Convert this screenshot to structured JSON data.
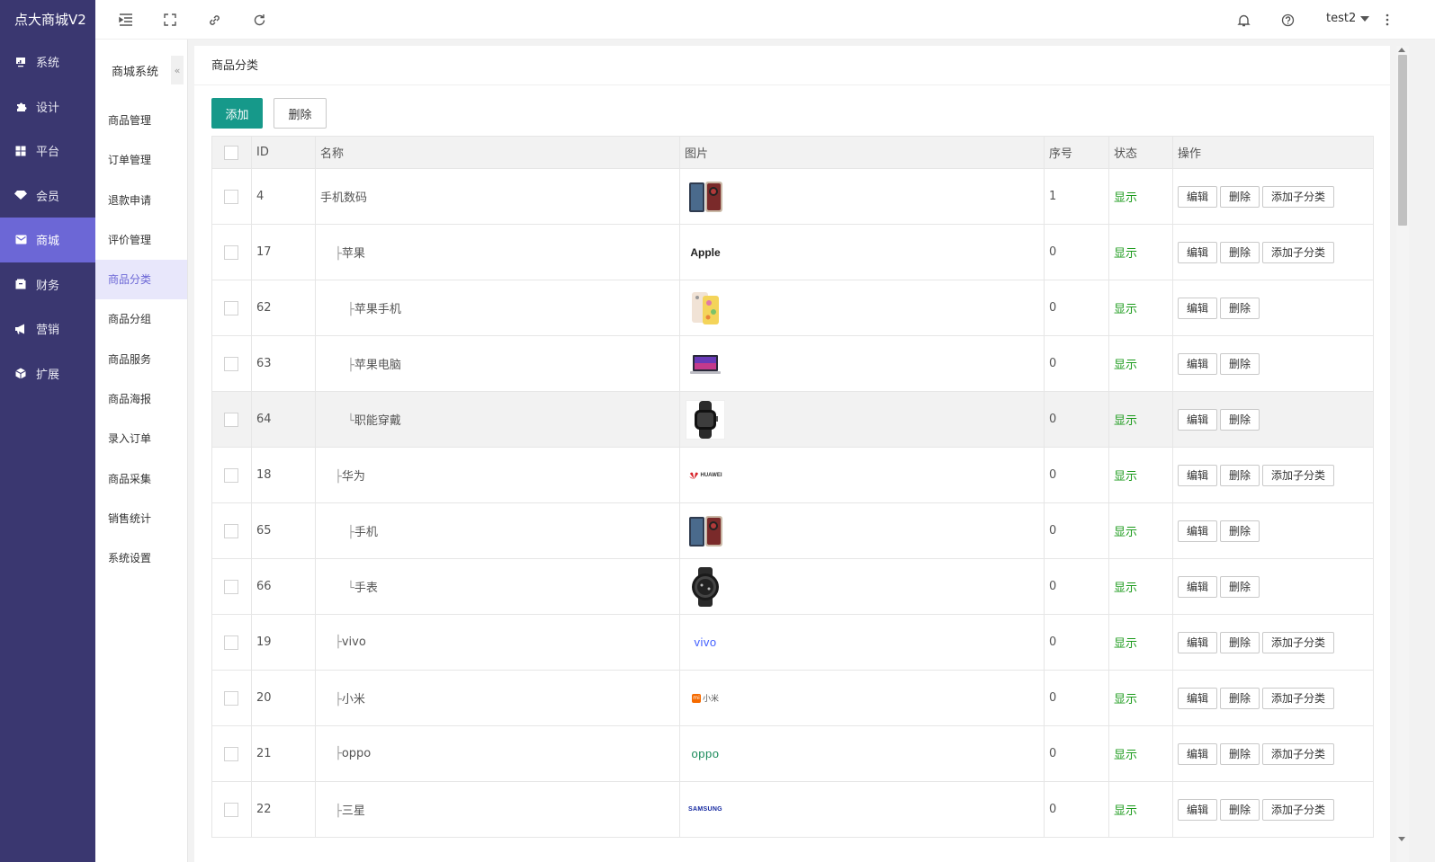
{
  "brand": "点大商城V2",
  "nav": [
    {
      "label": "系统",
      "icon": "monitor-icon"
    },
    {
      "label": "设计",
      "icon": "puzzle-icon"
    },
    {
      "label": "平台",
      "icon": "grid-icon"
    },
    {
      "label": "会员",
      "icon": "diamond-icon"
    },
    {
      "label": "商城",
      "icon": "mail-icon"
    },
    {
      "label": "财务",
      "icon": "wallet-icon"
    },
    {
      "label": "营销",
      "icon": "megaphone-icon"
    },
    {
      "label": "扩展",
      "icon": "cube-icon"
    }
  ],
  "subnav": {
    "title": "商城系统",
    "collapse": "«",
    "items": [
      "商品管理",
      "订单管理",
      "退款申请",
      "评价管理",
      "商品分类",
      "商品分组",
      "商品服务",
      "商品海报",
      "录入订单",
      "商品采集",
      "销售统计",
      "系统设置"
    ]
  },
  "topbar": {
    "user": "test2"
  },
  "page": {
    "title": "商品分类",
    "add_label": "添加",
    "delete_label": "删除"
  },
  "table": {
    "headers": [
      "ID",
      "名称",
      "图片",
      "序号",
      "状态",
      "操作"
    ],
    "rows": [
      {
        "id": "4",
        "name": "手机数码",
        "prefix": "",
        "level": 0,
        "image": "phone",
        "order": "1",
        "status": "显示",
        "sub": true
      },
      {
        "id": "17",
        "name": "苹果",
        "prefix": "├",
        "level": 1,
        "image": "apple",
        "order": "0",
        "status": "显示",
        "sub": true
      },
      {
        "id": "62",
        "name": "苹果手机",
        "prefix": "├",
        "level": 2,
        "image": "iphone",
        "order": "0",
        "status": "显示",
        "sub": false
      },
      {
        "id": "63",
        "name": "苹果电脑",
        "prefix": "├",
        "level": 2,
        "image": "macbook",
        "order": "0",
        "status": "显示",
        "sub": false
      },
      {
        "id": "64",
        "name": "职能穿戴",
        "prefix": "└",
        "level": 2,
        "image": "watch",
        "order": "0",
        "status": "显示",
        "sub": false
      },
      {
        "id": "18",
        "name": "华为",
        "prefix": "├",
        "level": 1,
        "image": "huawei",
        "order": "0",
        "status": "显示",
        "sub": true
      },
      {
        "id": "65",
        "name": "手机",
        "prefix": "├",
        "level": 2,
        "image": "phone",
        "order": "0",
        "status": "显示",
        "sub": false
      },
      {
        "id": "66",
        "name": "手表",
        "prefix": "└",
        "level": 2,
        "image": "roundwatch",
        "order": "0",
        "status": "显示",
        "sub": false
      },
      {
        "id": "19",
        "name": "vivo",
        "prefix": "├",
        "level": 1,
        "image": "vivo",
        "order": "0",
        "status": "显示",
        "sub": true
      },
      {
        "id": "20",
        "name": "小米",
        "prefix": "├",
        "level": 1,
        "image": "xiaomi",
        "order": "0",
        "status": "显示",
        "sub": true
      },
      {
        "id": "21",
        "name": "oppo",
        "prefix": "├",
        "level": 1,
        "image": "oppo",
        "order": "0",
        "status": "显示",
        "sub": true
      },
      {
        "id": "22",
        "name": "三星",
        "prefix": "├",
        "level": 1,
        "image": "samsung",
        "order": "0",
        "status": "显示",
        "sub": true
      }
    ],
    "edit_label": "编辑",
    "delete_label": "删除",
    "add_sub_label": "添加子分类"
  },
  "logos": {
    "apple": "Apple",
    "huawei": "HUAWEI",
    "vivo": "vivo",
    "xiaomi": "小米",
    "xiaomi_mark": "mi",
    "oppo": "oppo",
    "samsung": "SAMSUNG"
  },
  "colors": {
    "sidebar": "#3a3770",
    "active": "#6c67d6",
    "primary_button": "#16998a",
    "status": "#1a9a1a"
  }
}
